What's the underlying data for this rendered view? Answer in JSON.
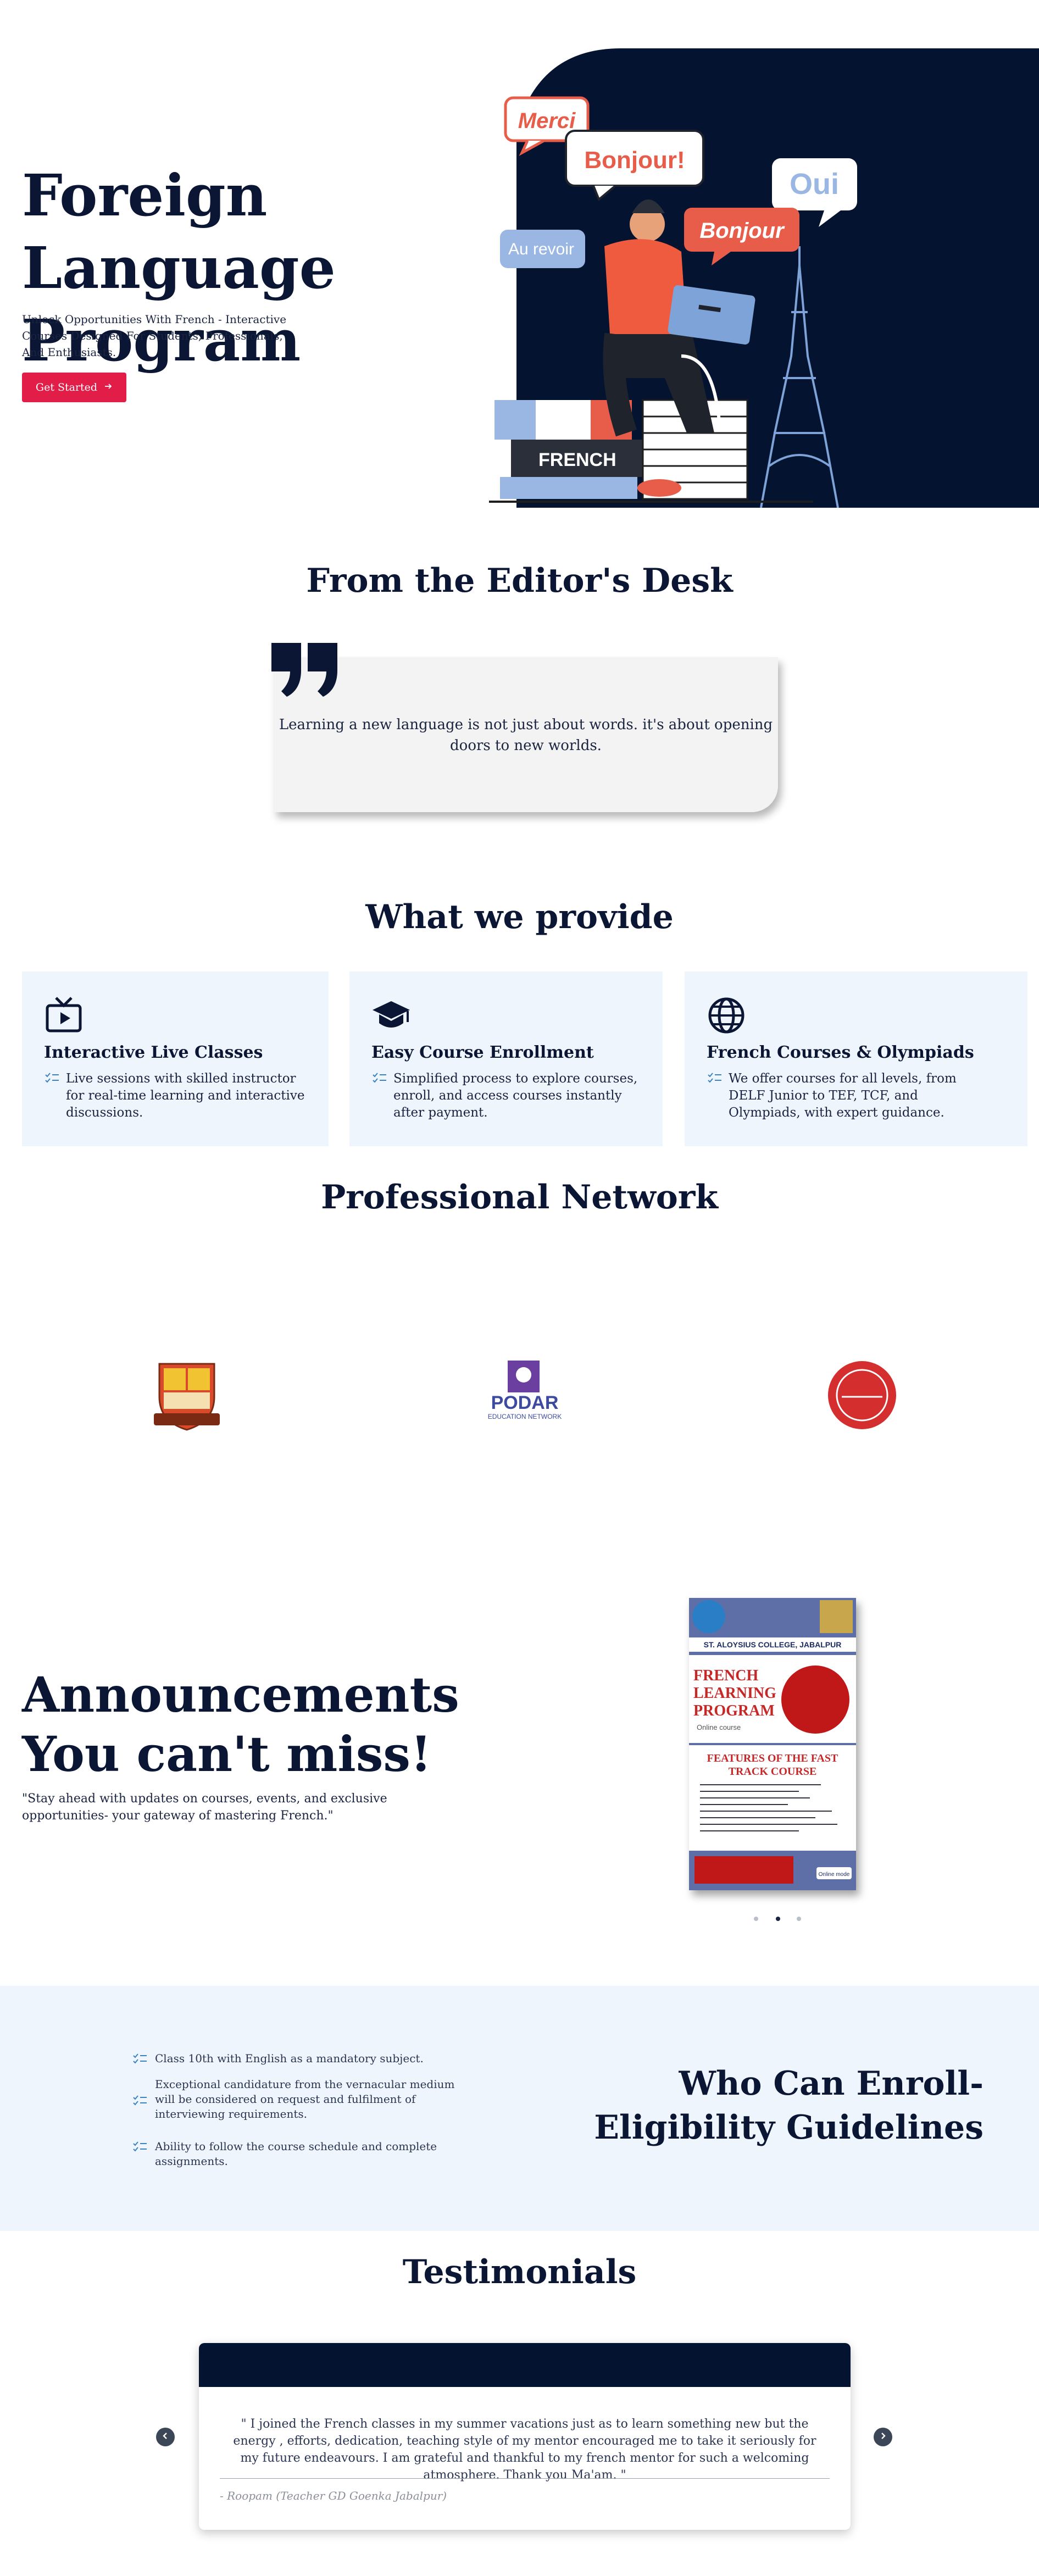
{
  "hero": {
    "title": "Foreign Language Program",
    "subtitle": "Unlock Opportunities With French - Interactive Courses Designed For Students, Professionals, And Enthusiasts.",
    "cta_label": "Get Started",
    "bubbles": [
      "Merci",
      "Bonjour!",
      "Oui",
      "Bonjour",
      "Au revoir"
    ],
    "book_label": "FRENCH"
  },
  "editor": {
    "title": "From the Editor's Desk",
    "quote": "Learning a new language is not just about words. it's about opening doors to new worlds."
  },
  "provide": {
    "title": "What we provide",
    "items": [
      {
        "icon": "tv-icon",
        "heading": "Interactive Live Classes",
        "body": "Live sessions with skilled instructor for real-time learning and interactive discussions."
      },
      {
        "icon": "graduation-cap-icon",
        "heading": "Easy Course Enrollment",
        "body": "Simplified process to explore courses, enroll, and access courses instantly after payment."
      },
      {
        "icon": "globe-icon",
        "heading": "French Courses & Olympiads",
        "body": "We offer courses for all levels, from DELF Junior to TEF, TCF, and Olympiads, with expert guidance."
      }
    ]
  },
  "network": {
    "title": "Professional Network",
    "podar_name": "PODAR",
    "podar_sub": "EDUCATION NETWORK"
  },
  "announcements": {
    "title": "Announcements You can't miss!",
    "subtitle": "\"Stay ahead with updates on courses, events, and exclusive opportunities- your gateway of mastering French.\"",
    "poster": {
      "college": "ST. ALOYSIUS COLLEGE, JABALPUR",
      "headline_1": "FRENCH",
      "headline_2": "LEARNING",
      "headline_3": "PROGRAM",
      "mode": "Online course",
      "features_title_1": "FEATURES OF THE FAST",
      "features_title_2": "TRACK COURSE",
      "enquire": "Online mode"
    }
  },
  "eligibility": {
    "title": "Who Can Enroll- Eligibility Guidelines",
    "items": [
      "Class 10th with English as a mandatory subject.",
      "Exceptional candidature from the vernacular medium will be considered on request and fulfilment of interviewing requirements.",
      "Ability to follow the course schedule and complete assignments."
    ]
  },
  "testimonials": {
    "title": "Testimonials",
    "quote": "\" I joined the French classes in my summer vacations just as to learn something new but the energy , efforts, dedication, teaching style of my mentor encouraged me to take it seriously for my future endeavours. I am grateful and thankful to my french mentor for such a welcoming atmosphere. Thank you Ma'am. \"",
    "author": "- Roopam (Teacher GD Goenka Jabalpur)"
  },
  "colors": {
    "navy": "#031330",
    "accent": "#e11d48",
    "card_bg": "#eef5fd",
    "check": "#3b82c4"
  }
}
